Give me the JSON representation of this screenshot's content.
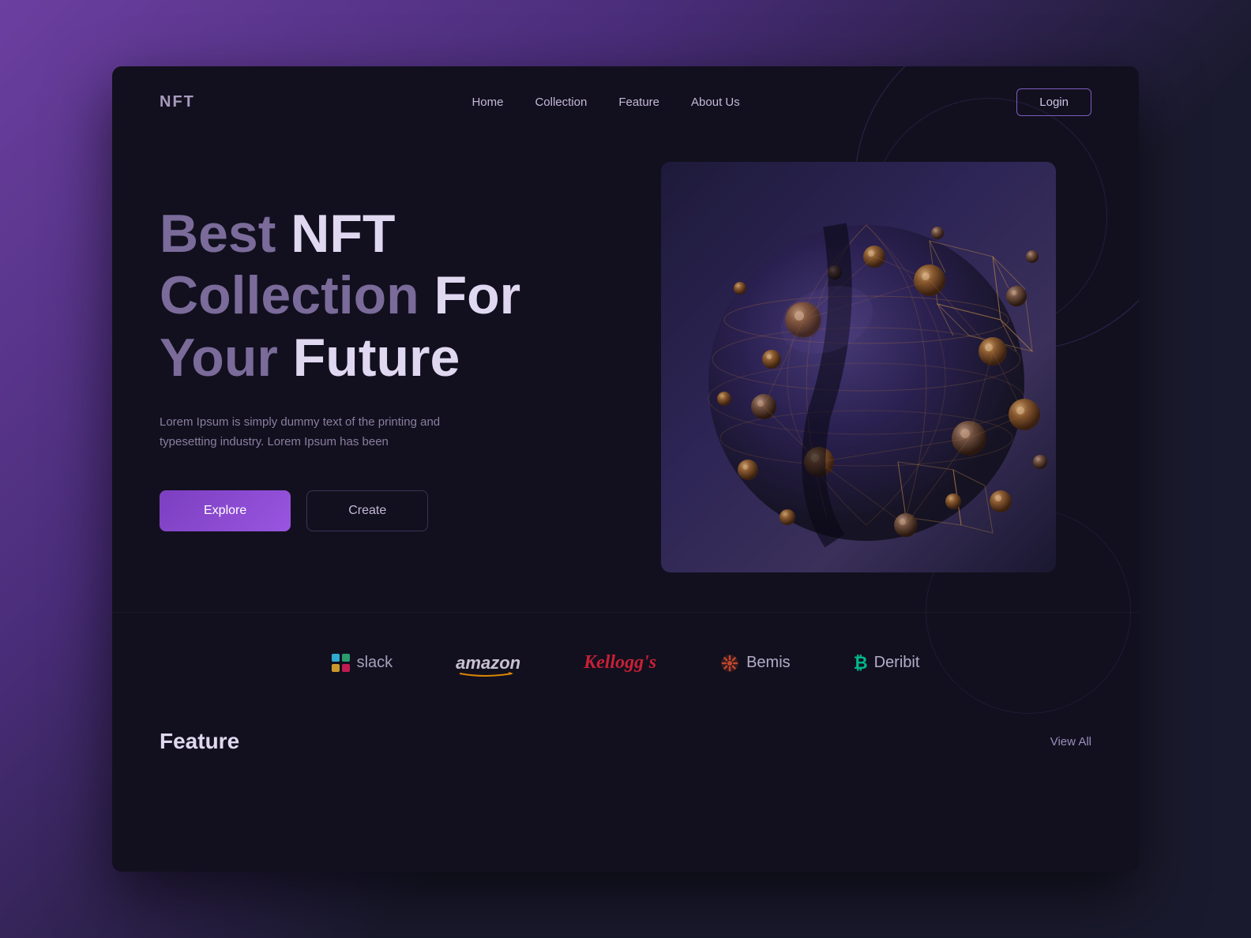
{
  "brand": {
    "name": "NFT"
  },
  "navbar": {
    "links": [
      {
        "label": "Home",
        "id": "home"
      },
      {
        "label": "Collection",
        "id": "collection"
      },
      {
        "label": "Feature",
        "id": "feature"
      },
      {
        "label": "About Us",
        "id": "about"
      }
    ],
    "login_label": "Login"
  },
  "hero": {
    "title_light1": "Best ",
    "title_bold1": "NFT",
    "title_light2": "Collection ",
    "title_bold2": "For",
    "title_light3": "Your ",
    "title_bold3": "Future",
    "description": "Lorem Ipsum is simply dummy text of the printing and typesetting industry. Lorem Ipsum has been",
    "btn_explore": "Explore",
    "btn_create": "Create"
  },
  "partners": [
    {
      "id": "slack",
      "name": "slack",
      "type": "slack"
    },
    {
      "id": "amazon",
      "name": "amazon",
      "type": "amazon"
    },
    {
      "id": "kelloggs",
      "name": "Kellogg's",
      "type": "kelloggs"
    },
    {
      "id": "bemis",
      "name": "Bemis",
      "type": "bemis"
    },
    {
      "id": "deribit",
      "name": "Deribit",
      "type": "deribit"
    }
  ],
  "footer": {
    "feature_label": "Feature",
    "view_all_label": "View All"
  }
}
